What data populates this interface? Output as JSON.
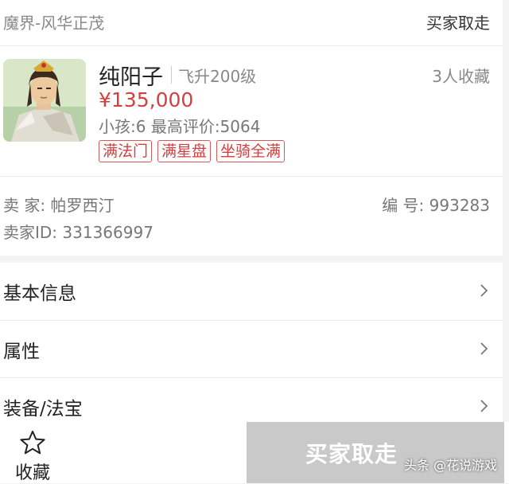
{
  "header": {
    "server": "魔界-风华正茂",
    "status": "买家取走"
  },
  "role": {
    "name": "纯阳子",
    "level": "飞升200级",
    "favorites": "3人收藏",
    "price": "¥135,000",
    "stats": "小孩:6 最高评价:5064",
    "tags": [
      "满法门",
      "满星盘",
      "坐骑全满"
    ]
  },
  "seller": {
    "seller_label": "卖 家: 帕罗西汀",
    "number_label": "编 号: 993283",
    "id_label": "卖家ID: 331366997"
  },
  "menu": {
    "items": [
      {
        "label": "基本信息",
        "icon": "chevron-right-icon"
      },
      {
        "label": "属性",
        "icon": "chevron-right-icon"
      },
      {
        "label": "装备/法宝",
        "icon": "chevron-right-icon"
      }
    ]
  },
  "bottom": {
    "favorite_label": "收藏",
    "favorite_icon": "star-outline-icon",
    "buy_label": "买家取走"
  },
  "watermark": "头条 @花说游戏",
  "colors": {
    "price": "#d33f3f",
    "tag_border": "#d65a5a",
    "disabled_button": "#c9c9c9"
  }
}
